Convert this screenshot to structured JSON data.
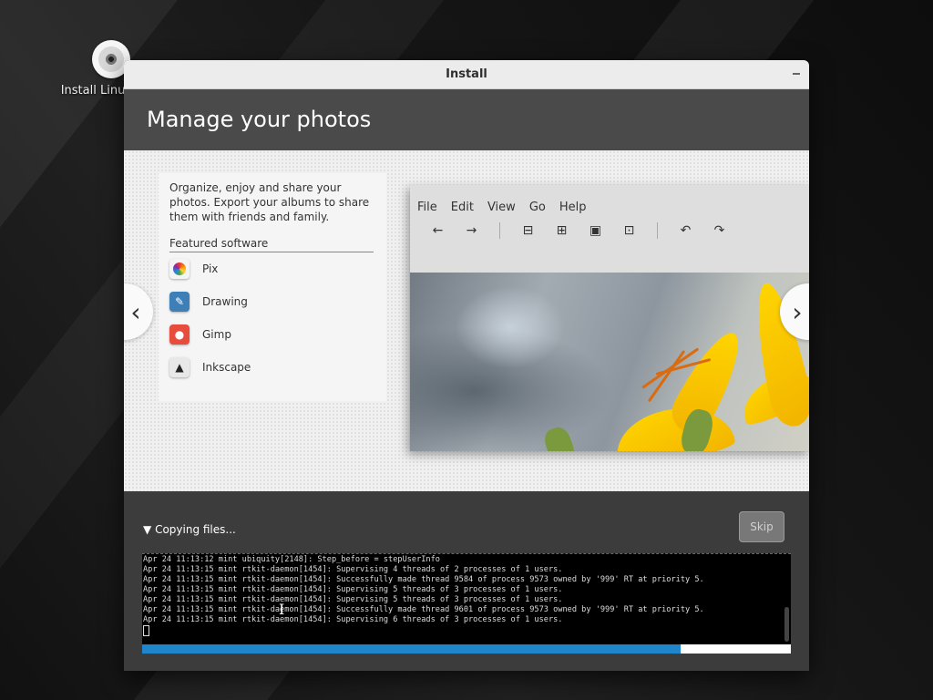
{
  "desktop": {
    "icon_label": "Install Linux Mint"
  },
  "window": {
    "title": "Install"
  },
  "banner": {
    "title": "Manage your photos"
  },
  "slide": {
    "description": "Organize, enjoy and share your photos. Export your albums to share them with friends and family.",
    "featured_title": "Featured software",
    "software": [
      "Pix",
      "Drawing",
      "Gimp",
      "Inkscape"
    ],
    "app_menu": [
      "File",
      "Edit",
      "View",
      "Go",
      "Help"
    ],
    "toolbar_icons": [
      "arrow-left-icon",
      "arrow-right-icon",
      "zoom-out-icon",
      "zoom-in-icon",
      "zoom-actual-icon",
      "zoom-fit-icon",
      "rotate-left-icon",
      "rotate-right-icon"
    ]
  },
  "progress": {
    "label": "Copying files...",
    "skip_label": "Skip",
    "fraction": 0.83,
    "log_lines": [
      "Apr 24 11:13:12 mint ubiquity[2148]: Step_before = stepUserInfo",
      "Apr 24 11:13:15 mint rtkit-daemon[1454]: Supervising 4 threads of 2 processes of 1 users.",
      "Apr 24 11:13:15 mint rtkit-daemon[1454]: Successfully made thread 9584 of process 9573 owned by '999' RT at priority 5.",
      "Apr 24 11:13:15 mint rtkit-daemon[1454]: Supervising 5 threads of 3 processes of 1 users.",
      "Apr 24 11:13:15 mint rtkit-daemon[1454]: Supervising 5 threads of 3 processes of 1 users.",
      "Apr 24 11:13:15 mint rtkit-daemon[1454]: Successfully made thread 9601 of process 9573 owned by '999' RT at priority 5.",
      "Apr 24 11:13:15 mint rtkit-daemon[1454]: Supervising 6 threads of 3 processes of 1 users."
    ]
  },
  "colors": {
    "accent": "#1f86cc",
    "banner": "#4a4a4a",
    "titlebar": "#ececec"
  }
}
